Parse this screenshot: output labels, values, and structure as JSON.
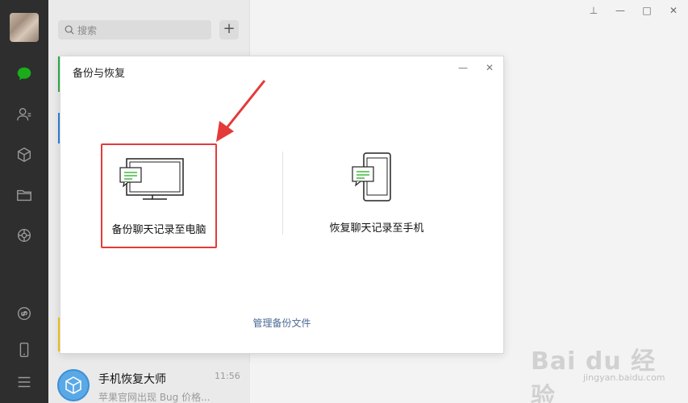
{
  "window": {
    "controls": {
      "pin": "⊥",
      "minimize": "—",
      "maximize": "□",
      "close": "✕"
    }
  },
  "nav": {
    "icons": [
      "chat-icon",
      "contacts-icon",
      "box-icon",
      "folder-icon",
      "moments-icon",
      "link-icon",
      "phone-icon",
      "menu-icon"
    ]
  },
  "search": {
    "placeholder": "搜索"
  },
  "add_button": {
    "label": "+"
  },
  "chat_item": {
    "name": "手机恢复大师",
    "time": "11:56",
    "preview": "苹果官网出现 Bug 价格..."
  },
  "dialog": {
    "title": "备份与恢复",
    "minimize": "—",
    "close": "✕",
    "option_backup": {
      "label": "备份聊天记录至电脑"
    },
    "option_restore": {
      "label": "恢复聊天记录至手机"
    },
    "manage_link": "管理备份文件"
  },
  "watermark": {
    "brand": "Bai du 经验",
    "url": "jingyan.baidu.com"
  },
  "colors": {
    "nav_bg": "#2e2e2e",
    "accent_green": "#1aad19",
    "highlight_red": "#e43a3a",
    "link_blue": "#4a6a96"
  }
}
